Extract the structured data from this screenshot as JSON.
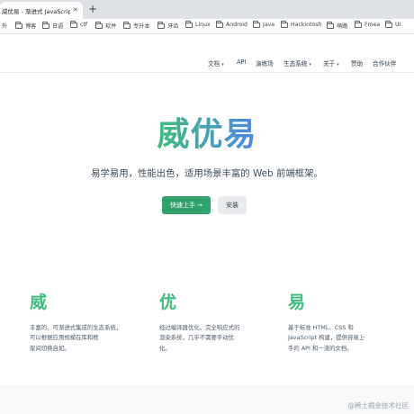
{
  "browser": {
    "tab_title": "威优易 - 渐进式 JavaScript 框",
    "tab_close": "×",
    "new_tab": "+"
  },
  "bookmarks": [
    "外",
    "博客",
    "日语",
    "ctf",
    "软件",
    "专升本",
    "牙齿",
    "Linux",
    "Android",
    "Java",
    "Hackintosh",
    "萌路",
    "Fmea",
    "UI"
  ],
  "nav": {
    "docs": "文档",
    "api": "API",
    "playground": "演练场",
    "ecosystem": "生态系统",
    "about": "关于",
    "sponsor": "赞助",
    "partners": "合作伙伴",
    "caret": "▾"
  },
  "hero": {
    "title": "威优易",
    "tagline": "易学易用，性能出色，适用场景丰富的 Web 前端框架。",
    "primary_button": "快速上手 →",
    "secondary_button": "安装"
  },
  "features": [
    {
      "title": "威",
      "lines": [
        "丰富的、可渐进式集成的生态系统，",
        "可以根据应用规模在库和框",
        "架间切换自如。"
      ]
    },
    {
      "title": "优",
      "lines": [
        "经过编译器优化、完全响应式的",
        "渲染系统，几乎不需要手动优",
        "化。"
      ]
    },
    {
      "title": "易",
      "lines": [
        "基于标准 HTML、CSS 和",
        "JavaScript 构建，提供容易上",
        "手的 API 和一流的文档。"
      ]
    }
  ],
  "watermark": "@稀土掘金技术社区",
  "colors": {
    "brand_green": "#3dbd7d",
    "brand_blue": "#4d86e6",
    "button_green": "#2fa36c"
  }
}
